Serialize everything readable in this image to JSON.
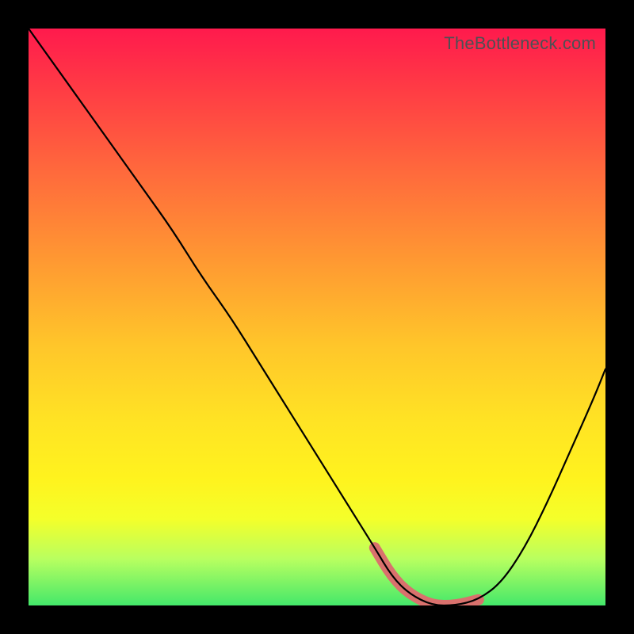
{
  "watermark": "TheBottleneck.com",
  "chart_data": {
    "type": "line",
    "title": "",
    "xlabel": "",
    "ylabel": "",
    "xlim": [
      0,
      100
    ],
    "ylim": [
      0,
      100
    ],
    "series": [
      {
        "name": "curve",
        "x": [
          0,
          5,
          10,
          15,
          20,
          25,
          30,
          35,
          40,
          45,
          50,
          55,
          60,
          63,
          66,
          70,
          74,
          78,
          82,
          86,
          90,
          94,
          98,
          100
        ],
        "values": [
          100,
          93,
          86,
          79,
          72,
          65,
          57,
          50,
          42,
          34,
          26,
          18,
          10,
          5,
          2,
          0,
          0,
          1,
          4,
          10,
          18,
          27,
          36,
          41
        ]
      }
    ],
    "accent_region": {
      "x_start": 60,
      "x_end": 78
    },
    "gradient_stops": [
      {
        "pos": 0,
        "color": "#ff1a4d"
      },
      {
        "pos": 25,
        "color": "#ff6a3c"
      },
      {
        "pos": 55,
        "color": "#ffc62a"
      },
      {
        "pos": 78,
        "color": "#fff31e"
      },
      {
        "pos": 100,
        "color": "#44e86a"
      }
    ]
  }
}
